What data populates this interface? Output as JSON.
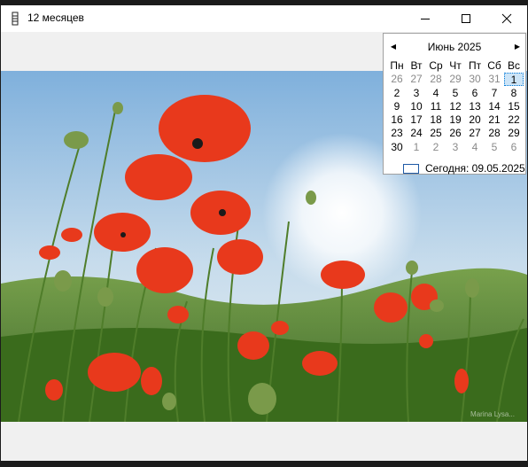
{
  "window": {
    "title": "12 месяцев"
  },
  "calendar": {
    "month_title": "Июнь 2025",
    "prev_glyph": "◀",
    "next_glyph": "▶",
    "weekdays": [
      "Пн",
      "Вт",
      "Ср",
      "Чт",
      "Пт",
      "Сб",
      "Вс"
    ],
    "weeks": [
      [
        "26",
        "27",
        "28",
        "29",
        "30",
        "31",
        "1"
      ],
      [
        "2",
        "3",
        "4",
        "5",
        "6",
        "7",
        "8"
      ],
      [
        "9",
        "10",
        "11",
        "12",
        "13",
        "14",
        "15"
      ],
      [
        "16",
        "17",
        "18",
        "19",
        "20",
        "21",
        "22"
      ],
      [
        "23",
        "24",
        "25",
        "26",
        "27",
        "28",
        "29"
      ],
      [
        "30",
        "1",
        "2",
        "3",
        "4",
        "5",
        "6"
      ]
    ],
    "today_label": "Сегодня: 09.05.2025"
  },
  "photo": {
    "watermark": "Marina Lysa... "
  },
  "colors": {
    "sky": "#9ec4e4",
    "poppy": "#e8391c",
    "grass": "#3c6d1f"
  }
}
